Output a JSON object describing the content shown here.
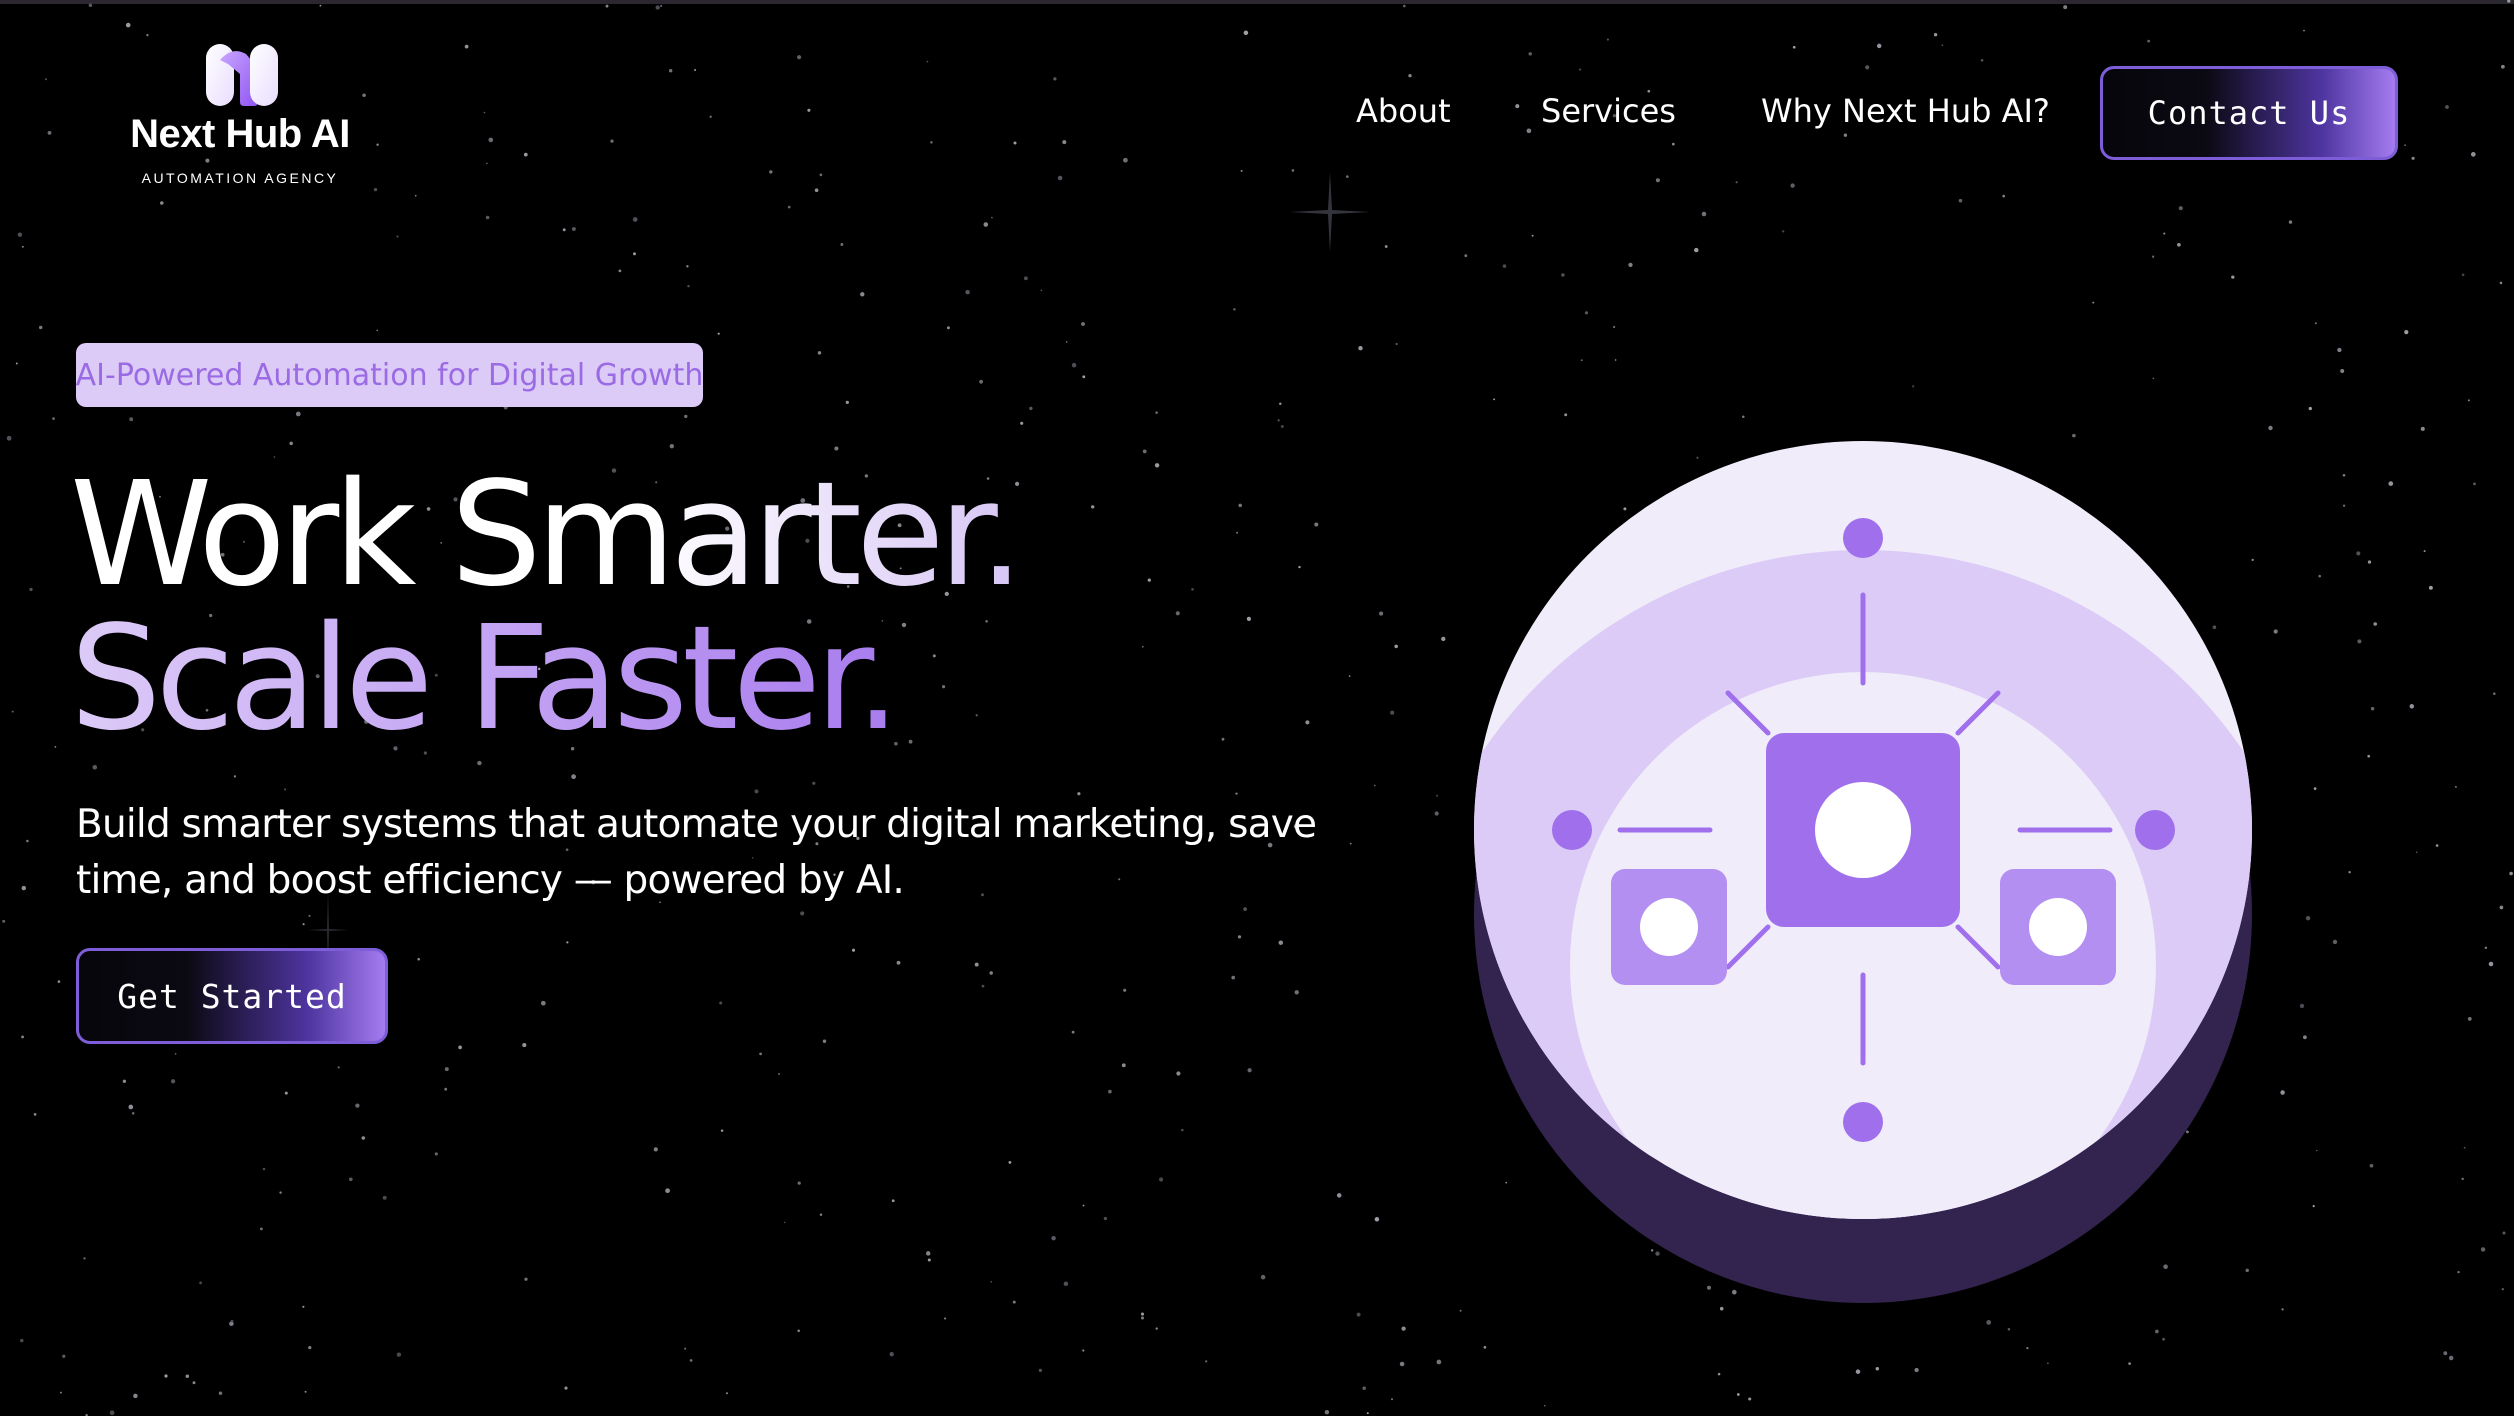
{
  "brand": {
    "name": "Next Hub AI",
    "tagline": "AUTOMATION AGENCY",
    "logo_icon": "stylized-n-logo-icon"
  },
  "nav": {
    "items": [
      {
        "label": "About"
      },
      {
        "label": "Services"
      },
      {
        "label": "Why Next Hub AI?"
      }
    ],
    "contact_label": "Contact Us"
  },
  "hero": {
    "badge": "AI-Powered Automation for Digital Growth",
    "headline_line1": "Work Smarter.",
    "headline_line2": "Scale Faster.",
    "subtext": "Build smarter systems that automate your digital marketing, save time, and boost efficiency — powered by AI.",
    "cta_label": "Get Started",
    "illustration_icon": "automation-network-icon"
  },
  "colors": {
    "background": "#000000",
    "accent": "#a070ec",
    "badge_bg": "#dccbf6",
    "badge_text": "#9a6be4",
    "button_border": "#7e5ed8",
    "illustration_light": "#f0ecfa",
    "illustration_mid": "#dccbf7",
    "illustration_dark": "#32244e"
  }
}
